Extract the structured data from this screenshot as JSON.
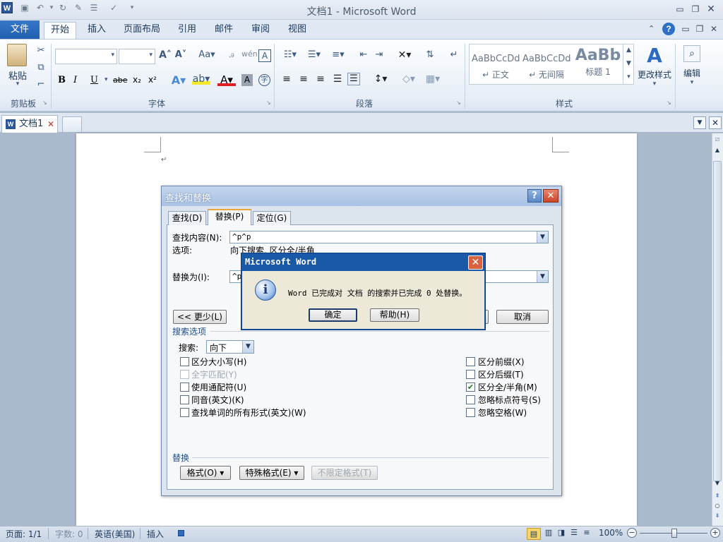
{
  "window": {
    "title": "文档1 - Microsoft Word",
    "logo": "W"
  },
  "tabs": {
    "file": "文件",
    "home": "开始",
    "insert": "插入",
    "layout": "页面布局",
    "references": "引用",
    "mailings": "邮件",
    "review": "审阅",
    "view": "视图"
  },
  "ribbon": {
    "paste": "粘贴",
    "groups": {
      "clipboard": "剪贴板",
      "font": "字体",
      "paragraph": "段落",
      "styles": "样式"
    },
    "styles": [
      {
        "preview": "AaBbCcDd",
        "name": "↵ 正文"
      },
      {
        "preview": "AaBbCcDd",
        "name": "↵ 无间隔"
      },
      {
        "preview": "AaBb",
        "name": "标题 1"
      }
    ],
    "change_styles": "更改样式",
    "edit": "编辑",
    "font_buttons": {
      "bold": "B",
      "italic": "I",
      "underline": "U",
      "strike": "abe",
      "sub": "x₂",
      "sup": "x²"
    }
  },
  "doc_tab": {
    "label": "文档1"
  },
  "document": {
    "paragraph_mark": "↵"
  },
  "find_replace": {
    "title": "查找和替换",
    "tabs": [
      "查找(D)",
      "替换(P)",
      "定位(G)"
    ],
    "find_label": "查找内容(N):",
    "find_value": "^p^p",
    "options_label": "选项:",
    "options_value": "向下搜索, 区分全/半角",
    "replace_label": "替换为(I):",
    "replace_value": "^p",
    "less_button": "<< 更少(L)",
    "cancel_button": "取消",
    "search_options_title": "搜索选项",
    "search_label": "搜索:",
    "search_value": "向下",
    "left_checks": [
      {
        "label": "区分大小写(H)",
        "checked": false,
        "disabled": false
      },
      {
        "label": "全字匹配(Y)",
        "checked": false,
        "disabled": true
      },
      {
        "label": "使用通配符(U)",
        "checked": false,
        "disabled": false
      },
      {
        "label": "同音(英文)(K)",
        "checked": false,
        "disabled": false
      },
      {
        "label": "查找单词的所有形式(英文)(W)",
        "checked": false,
        "disabled": false
      }
    ],
    "right_checks": [
      {
        "label": "区分前缀(X)",
        "checked": false
      },
      {
        "label": "区分后缀(T)",
        "checked": false
      },
      {
        "label": "区分全/半角(M)",
        "checked": true
      },
      {
        "label": "忽略标点符号(S)",
        "checked": false
      },
      {
        "label": "忽略空格(W)",
        "checked": false
      }
    ],
    "replace_section": "替换",
    "format_button": "格式(O) ▾",
    "special_button": "特殊格式(E) ▾",
    "no_format_button": "不限定格式(T)"
  },
  "message_box": {
    "title": "Microsoft Word",
    "message": "Word 已完成对 文档 的搜索并已完成 0 处替换。",
    "ok_button": "确定",
    "help_button": "帮助(H)"
  },
  "status": {
    "page": "页面: 1/1",
    "words": "字数: 0",
    "language": "英语(美国)",
    "mode": "插入",
    "zoom": "100%"
  }
}
